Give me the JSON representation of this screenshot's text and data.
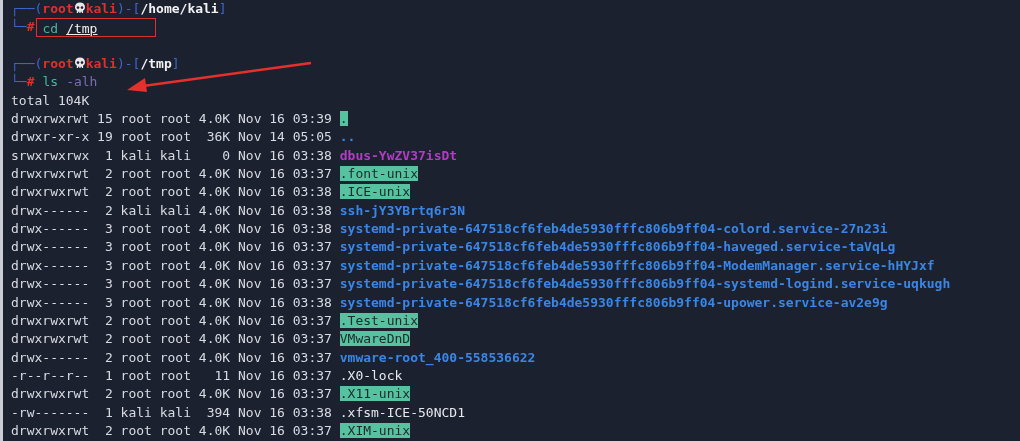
{
  "terminal": {
    "prompts": [
      {
        "open": "┌──(",
        "user": "root",
        "host": "kali",
        "sep": ")-[",
        "path": "/home/kali",
        "close": "]",
        "corner": "└─",
        "sigil": "#",
        "command": "cd",
        "args": [
          {
            "text": "/tmp",
            "kind": "path"
          }
        ],
        "kind": "boxed"
      },
      {
        "open": "┌──(",
        "user": "root",
        "host": "kali",
        "sep": ")-[",
        "path": "/tmp",
        "close": "]",
        "corner": "└─",
        "sigil": "#",
        "command": "ls",
        "args": [
          {
            "text": "-alh",
            "kind": "option"
          }
        ],
        "kind": "pointed"
      }
    ],
    "total": "total 104K",
    "entries": [
      {
        "mode": "drwxrwxrwt",
        "links": "15",
        "owner": "root",
        "group": "root",
        "size": "4.0K",
        "month": "Nov",
        "day": "16",
        "time": "03:39",
        "name": ".",
        "kind": "sticky"
      },
      {
        "mode": "drwxr-xr-x",
        "links": "19",
        "owner": "root",
        "group": "root",
        "size": "36K",
        "month": "Nov",
        "day": "14",
        "time": "05:05",
        "name": "..",
        "kind": "dir"
      },
      {
        "mode": "srwxrwxrwx",
        "links": "1",
        "owner": "kali",
        "group": "kali",
        "size": "0",
        "month": "Nov",
        "day": "16",
        "time": "03:38",
        "name": "dbus-YwZV37isDt",
        "kind": "socket"
      },
      {
        "mode": "drwxrwxrwt",
        "links": "2",
        "owner": "root",
        "group": "root",
        "size": "4.0K",
        "month": "Nov",
        "day": "16",
        "time": "03:37",
        "name": ".font-unix",
        "kind": "sticky"
      },
      {
        "mode": "drwxrwxrwt",
        "links": "2",
        "owner": "root",
        "group": "root",
        "size": "4.0K",
        "month": "Nov",
        "day": "16",
        "time": "03:38",
        "name": ".ICE-unix",
        "kind": "sticky"
      },
      {
        "mode": "drwx------",
        "links": "2",
        "owner": "kali",
        "group": "kali",
        "size": "4.0K",
        "month": "Nov",
        "day": "16",
        "time": "03:38",
        "name": "ssh-jY3YBrtq6r3N",
        "kind": "dir"
      },
      {
        "mode": "drwx------",
        "links": "3",
        "owner": "root",
        "group": "root",
        "size": "4.0K",
        "month": "Nov",
        "day": "16",
        "time": "03:38",
        "name": "systemd-private-647518cf6feb4de5930fffc806b9ff04-colord.service-27n23i",
        "kind": "dir"
      },
      {
        "mode": "drwx------",
        "links": "3",
        "owner": "root",
        "group": "root",
        "size": "4.0K",
        "month": "Nov",
        "day": "16",
        "time": "03:37",
        "name": "systemd-private-647518cf6feb4de5930fffc806b9ff04-haveged.service-taVqLg",
        "kind": "dir"
      },
      {
        "mode": "drwx------",
        "links": "3",
        "owner": "root",
        "group": "root",
        "size": "4.0K",
        "month": "Nov",
        "day": "16",
        "time": "03:37",
        "name": "systemd-private-647518cf6feb4de5930fffc806b9ff04-ModemManager.service-hHYJxf",
        "kind": "dir"
      },
      {
        "mode": "drwx------",
        "links": "3",
        "owner": "root",
        "group": "root",
        "size": "4.0K",
        "month": "Nov",
        "day": "16",
        "time": "03:37",
        "name": "systemd-private-647518cf6feb4de5930fffc806b9ff04-systemd-logind.service-uqkugh",
        "kind": "dir"
      },
      {
        "mode": "drwx------",
        "links": "3",
        "owner": "root",
        "group": "root",
        "size": "4.0K",
        "month": "Nov",
        "day": "16",
        "time": "03:38",
        "name": "systemd-private-647518cf6feb4de5930fffc806b9ff04-upower.service-av2e9g",
        "kind": "dir"
      },
      {
        "mode": "drwxrwxrwt",
        "links": "2",
        "owner": "root",
        "group": "root",
        "size": "4.0K",
        "month": "Nov",
        "day": "16",
        "time": "03:37",
        "name": ".Test-unix",
        "kind": "sticky"
      },
      {
        "mode": "drwxrwxrwt",
        "links": "2",
        "owner": "root",
        "group": "root",
        "size": "4.0K",
        "month": "Nov",
        "day": "16",
        "time": "03:37",
        "name": "VMwareDnD",
        "kind": "sticky"
      },
      {
        "mode": "drwx------",
        "links": "2",
        "owner": "root",
        "group": "root",
        "size": "4.0K",
        "month": "Nov",
        "day": "16",
        "time": "03:37",
        "name": "vmware-root_400-558536622",
        "kind": "dir"
      },
      {
        "mode": "-r--r--r--",
        "links": "1",
        "owner": "root",
        "group": "root",
        "size": "11",
        "month": "Nov",
        "day": "16",
        "time": "03:37",
        "name": ".X0-lock",
        "kind": "file"
      },
      {
        "mode": "drwxrwxrwt",
        "links": "2",
        "owner": "root",
        "group": "root",
        "size": "4.0K",
        "month": "Nov",
        "day": "16",
        "time": "03:37",
        "name": ".X11-unix",
        "kind": "sticky"
      },
      {
        "mode": "-rw-------",
        "links": "1",
        "owner": "kali",
        "group": "kali",
        "size": "394",
        "month": "Nov",
        "day": "16",
        "time": "03:38",
        "name": ".xfsm-ICE-50NCD1",
        "kind": "file"
      },
      {
        "mode": "drwxrwxrwt",
        "links": "2",
        "owner": "root",
        "group": "root",
        "size": "4.0K",
        "month": "Nov",
        "day": "16",
        "time": "03:37",
        "name": ".XIM-unix",
        "kind": "sticky"
      }
    ]
  }
}
